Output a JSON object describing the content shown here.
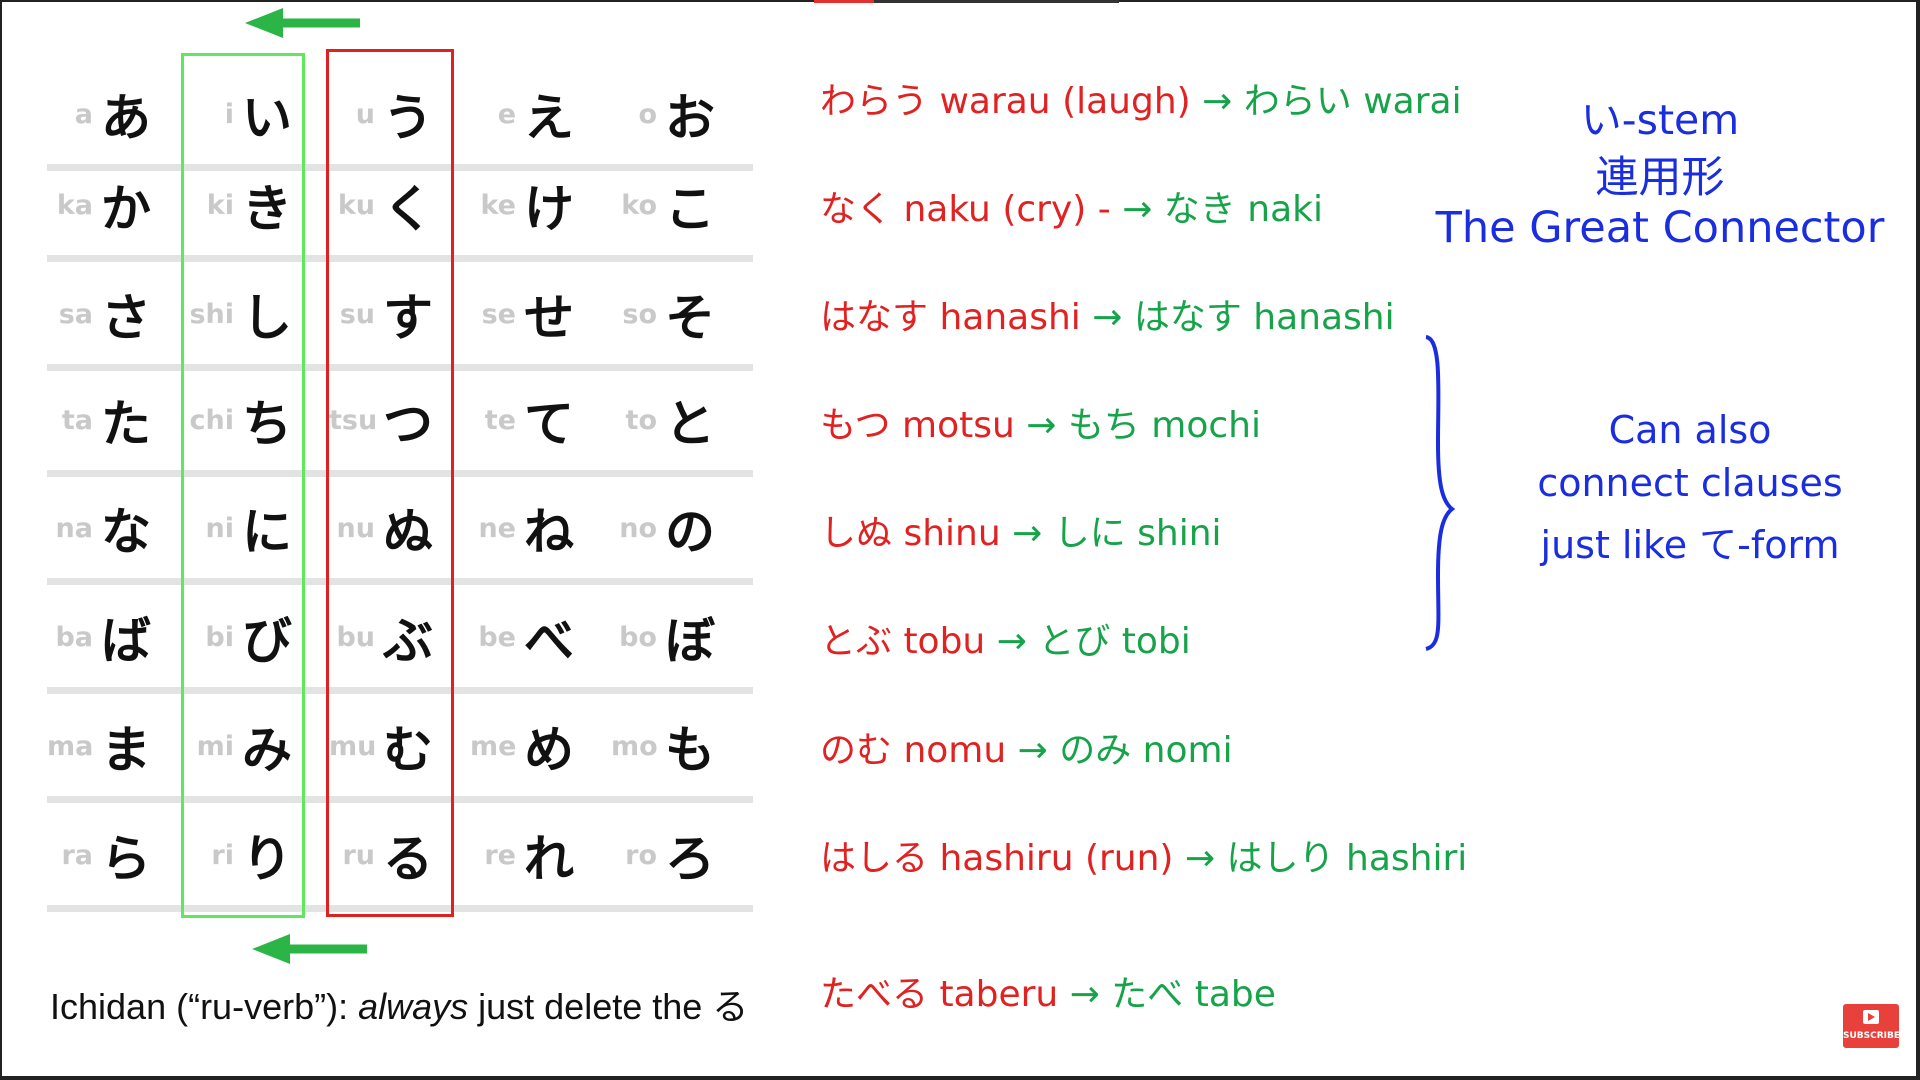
{
  "kana_table": {
    "rows": [
      [
        [
          "a",
          "あ"
        ],
        [
          "i",
          "い"
        ],
        [
          "u",
          "う"
        ],
        [
          "e",
          "え"
        ],
        [
          "o",
          "お"
        ]
      ],
      [
        [
          "ka",
          "か"
        ],
        [
          "ki",
          "き"
        ],
        [
          "ku",
          "く"
        ],
        [
          "ke",
          "け"
        ],
        [
          "ko",
          "こ"
        ]
      ],
      [
        [
          "sa",
          "さ"
        ],
        [
          "shi",
          "し"
        ],
        [
          "su",
          "す"
        ],
        [
          "se",
          "せ"
        ],
        [
          "so",
          "そ"
        ]
      ],
      [
        [
          "ta",
          "た"
        ],
        [
          "chi",
          "ち"
        ],
        [
          "tsu",
          "つ"
        ],
        [
          "te",
          "て"
        ],
        [
          "to",
          "と"
        ]
      ],
      [
        [
          "na",
          "な"
        ],
        [
          "ni",
          "に"
        ],
        [
          "nu",
          "ぬ"
        ],
        [
          "ne",
          "ね"
        ],
        [
          "no",
          "の"
        ]
      ],
      [
        [
          "ba",
          "ば"
        ],
        [
          "bi",
          "び"
        ],
        [
          "bu",
          "ぶ"
        ],
        [
          "be",
          "べ"
        ],
        [
          "bo",
          "ぼ"
        ]
      ],
      [
        [
          "ma",
          "ま"
        ],
        [
          "mi",
          "み"
        ],
        [
          "mu",
          "む"
        ],
        [
          "me",
          "め"
        ],
        [
          "mo",
          "も"
        ]
      ],
      [
        [
          "ra",
          "ら"
        ],
        [
          "ri",
          "り"
        ],
        [
          "ru",
          "る"
        ],
        [
          "re",
          "れ"
        ],
        [
          "ro",
          "ろ"
        ]
      ]
    ]
  },
  "caption": {
    "pre": "Ichidan (“ru-verb”): ",
    "emph": "always",
    "post": " just delete the る"
  },
  "examples": [
    {
      "red": "わらう warau (laugh) ",
      "arrow": "→",
      "green": " わらい warai"
    },
    {
      "red": "なく naku (cry) - ",
      "arrow": "→",
      "green": " なき  naki"
    },
    {
      "red": "はなす hanashi ",
      "arrow": "→",
      "green": " はなす hanashi"
    },
    {
      "red": "もつ  motsu ",
      "arrow": "→",
      "green": " もち mochi"
    },
    {
      "red": "しぬ shinu ",
      "arrow": "→",
      "green": " しに shini"
    },
    {
      "red": "とぶ tobu ",
      "arrow": "→",
      "green": " とび  tobi"
    },
    {
      "red": "のむ nomu ",
      "arrow": "→",
      "green": " のみ  nomi"
    },
    {
      "red": "はしる hashiru (run)  ",
      "arrow": "→",
      "green": " はしり hashiri"
    },
    {
      "red": "たべる taberu ",
      "arrow": "→",
      "green": " たべ tabe"
    }
  ],
  "notes": {
    "line1": "い-stem",
    "line2": "連用形",
    "line3": "The Great Connector",
    "clause1": "Can also",
    "clause2": "connect clauses",
    "clause3": "just like て-form"
  },
  "subscribe_label": "SUBSCRIBE",
  "colors": {
    "green_box": "#5ee85e",
    "red_box": "#dd2222",
    "example_red": "#e02222",
    "example_green": "#17a34a",
    "note_blue": "#1a2ee0",
    "arrow_green": "#2bb546"
  }
}
